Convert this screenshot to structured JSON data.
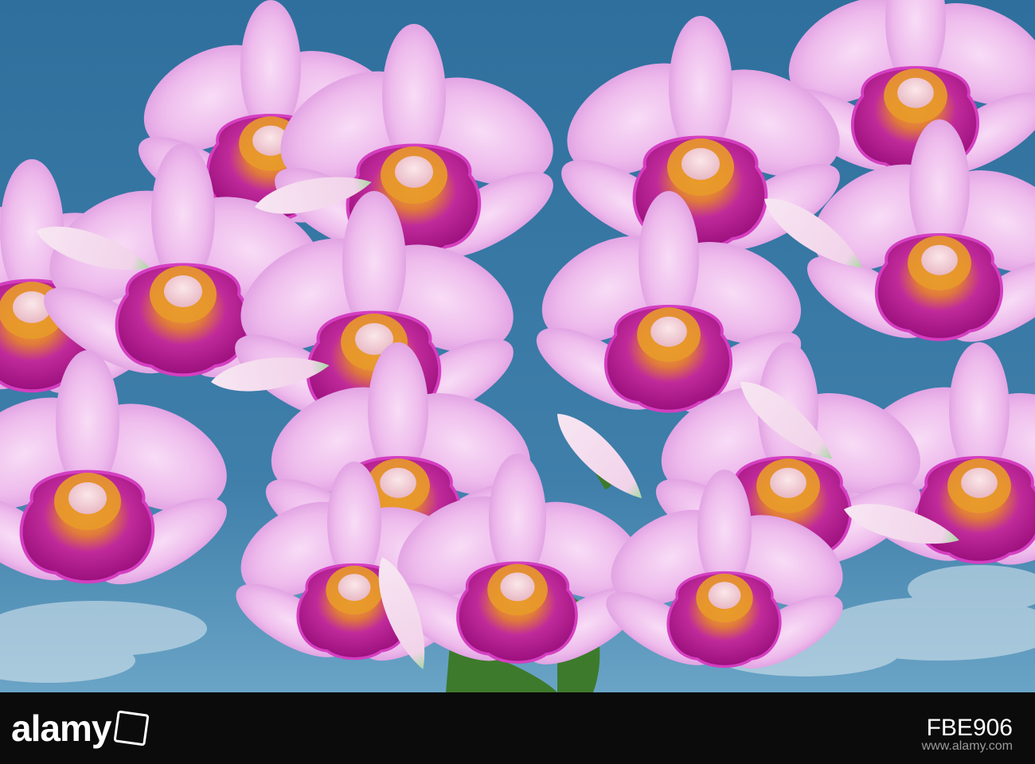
{
  "image": {
    "subject": "orchid-flowers",
    "colors": {
      "sky": "#3f7faa",
      "sky_light": "#7fb0cc",
      "petal": "#f1c2ef",
      "petal_dark": "#d98ee0",
      "lip": "#b3158f",
      "lip_edge": "#d43fc0",
      "throat": "#e89a2a",
      "column": "#f4d6d9",
      "leaf": "#3e7a2c",
      "bud_tip": "#a6d8a0",
      "banner": "#0b0b0b"
    }
  },
  "banner": {
    "logo_text": "alamy",
    "stock_id": "FBE906",
    "site_url": "www.alamy.com"
  }
}
